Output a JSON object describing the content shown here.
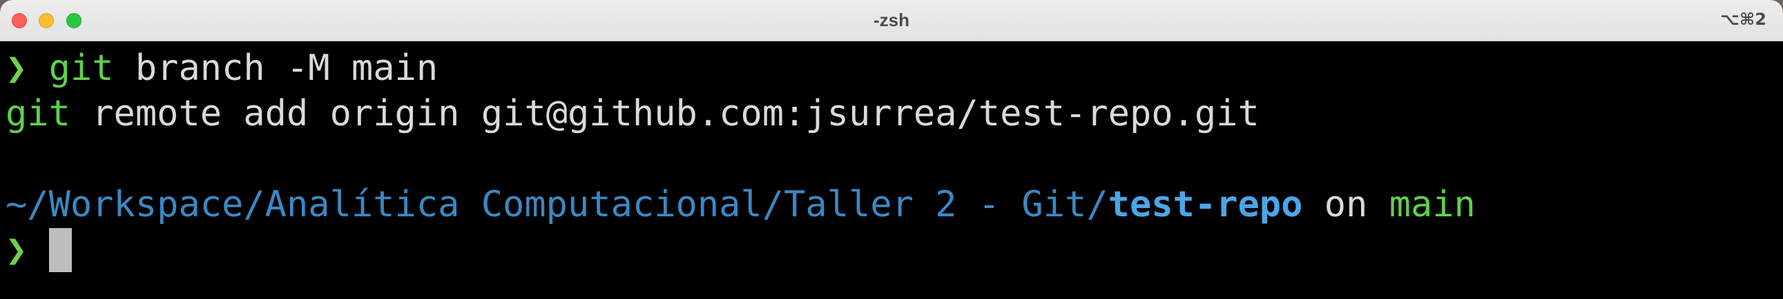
{
  "window": {
    "title": "-zsh",
    "shortcut": "⌥⌘2"
  },
  "terminal": {
    "line1": {
      "prompt": "❯",
      "cmd": "git",
      "rest": " branch -M main"
    },
    "line2": {
      "cmd": "git",
      "rest": " remote add origin git@github.com:jsurrea/test-repo.git"
    },
    "line4": {
      "path_prefix": "~/Workspace/Analítica Computacional/Taller 2 - Git/",
      "repo": "test-repo",
      "on": " on ",
      "branch": "main"
    },
    "line5": {
      "prompt": "❯"
    }
  },
  "colors": {
    "prompt": "#6fd14a",
    "command": "#5ed14a",
    "path": "#3b88c4",
    "repo": "#4aa6ea",
    "text": "#d9d9d9",
    "background": "#000000"
  }
}
